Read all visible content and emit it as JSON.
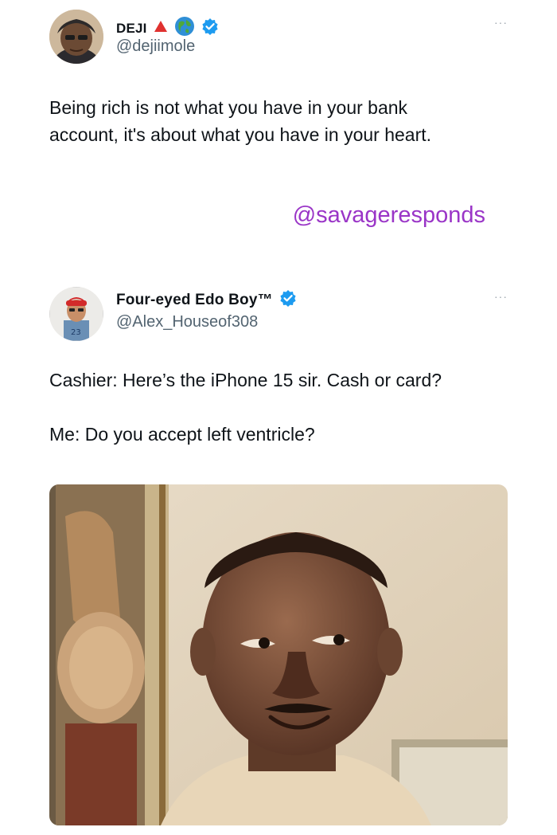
{
  "tweet1": {
    "name": "DEJI",
    "handle": "@dejiimole",
    "text_line1": "Being rich is not what you have in your bank",
    "text_line2": "account, it's about what you have in your heart.",
    "more": "···",
    "icons": [
      "red-triangle-icon",
      "globe-icon",
      "verified-badge-icon"
    ]
  },
  "watermark": "@savageresponds",
  "tweet2": {
    "name": "Four-eyed Edo Boy™",
    "handle": "@Alex_Houseof308",
    "line1": "Cashier: Here’s the iPhone 15 sir. Cash or card?",
    "line2": "Me: Do you accept left ventricle?",
    "more": "···",
    "icons": [
      "verified-badge-icon"
    ]
  },
  "colors": {
    "verified": "#1d9bf0",
    "watermark": "#9a35c7",
    "handle": "#536471",
    "text": "#0f1419"
  }
}
